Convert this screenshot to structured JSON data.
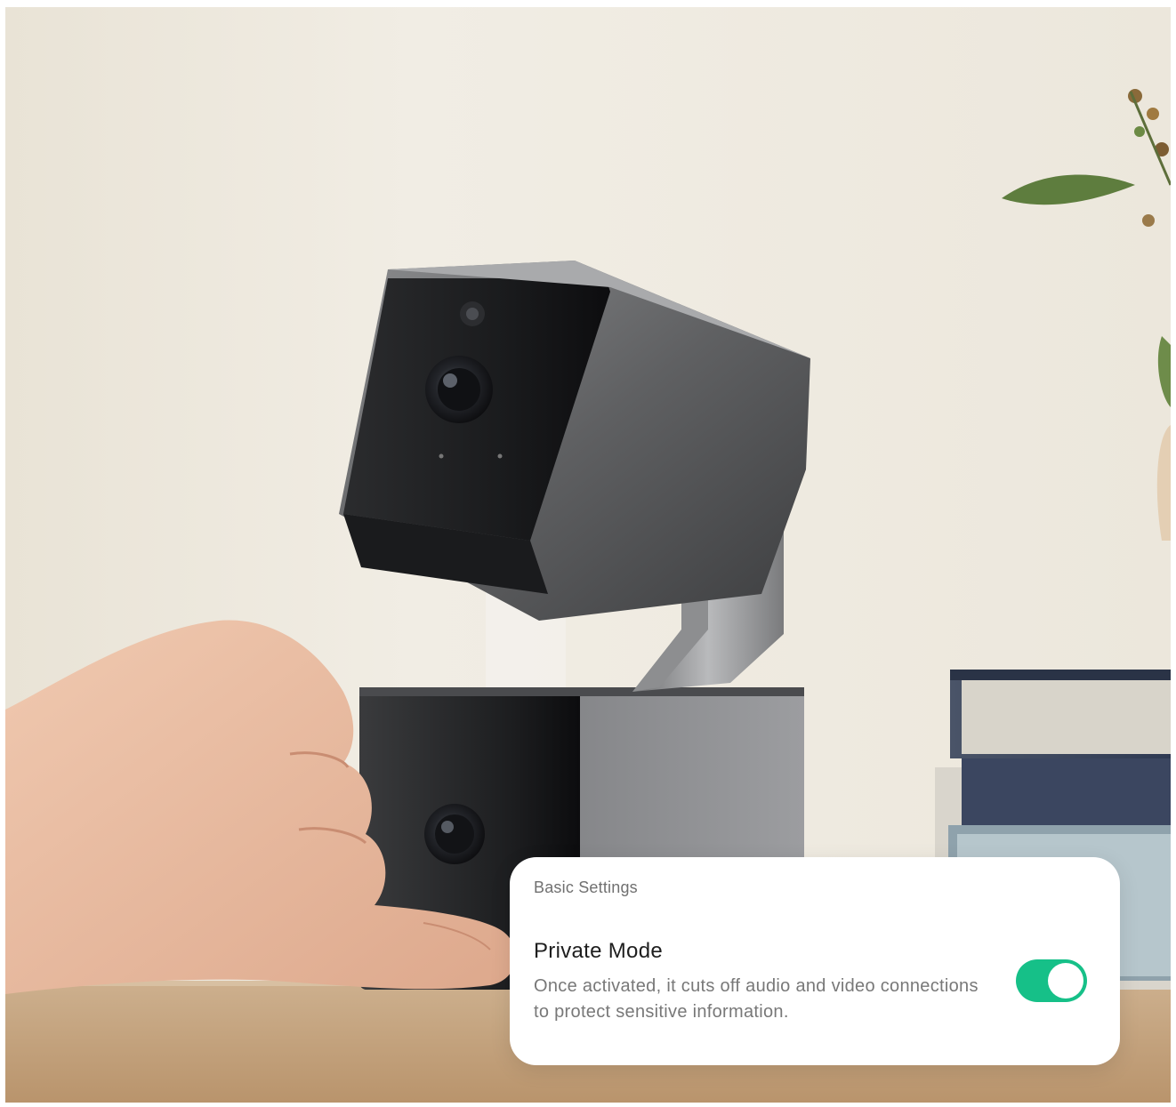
{
  "colors": {
    "wall": "#ece6dc",
    "desk": "#c9a984",
    "toggle_on": "#16c088",
    "card_bg": "#ffffff"
  },
  "settings_card": {
    "section_title": "Basic Settings",
    "items": [
      {
        "title": "Private Mode",
        "description": "Once activated, it cuts off audio and video connections to protect sensitive information.",
        "toggle_on": true
      }
    ]
  }
}
